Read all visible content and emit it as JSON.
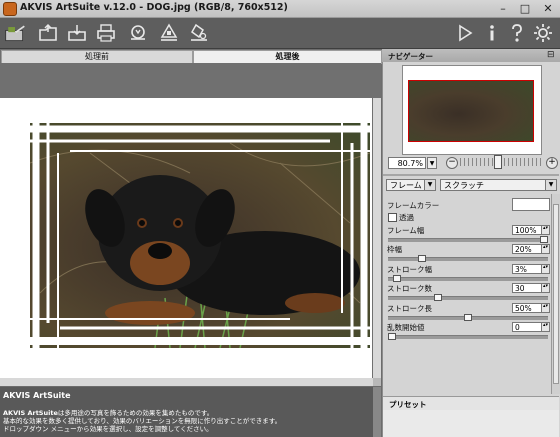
{
  "window": {
    "title": "AKVIS ArtSuite v.12.0 - DOG.jpg (RGB/8, 760x512)",
    "controls": [
      "–",
      "□",
      "✕"
    ]
  },
  "toolbar": {
    "buttons": [
      "home-icon",
      "open-icon",
      "save-icon",
      "print-icon",
      "share-icon",
      "before-icon",
      "after-icon"
    ],
    "right_buttons": [
      "run-icon",
      "info-icon",
      "help-icon",
      "settings-icon"
    ]
  },
  "tabs": {
    "before": "処理前",
    "after": "処理後"
  },
  "help": {
    "title": "AKVIS ArtSuite",
    "line1_brand": "AKVIS ArtSuite",
    "line1_rest": "は多用途の写真を飾るための効果を集めたものです。",
    "line2": "基本的な効果を数多く提供しており、効果のバリエーションを無限に作り出すことができます。",
    "line3": "ドロップダウン メニューから効果を選択し、設定を調整してください。"
  },
  "navigator": {
    "title": "ナビゲーター",
    "zoom": "80.7%",
    "zoom_position": 0.45
  },
  "effect": {
    "category": "フレーム",
    "type": "スクラッチ"
  },
  "settings": {
    "frame_color_label": "フレームカラー",
    "frame_color": "#ffffff",
    "transparent_label": "透過",
    "transparent_checked": false,
    "frame_width": {
      "label": "フレーム幅",
      "value": "100%",
      "level": 1.0
    },
    "border_width": {
      "label": "枠幅",
      "value": "20%",
      "level": 0.2
    },
    "stroke_width": {
      "label": "ストローク幅",
      "value": "3%",
      "level": 0.03
    },
    "stroke_count": {
      "label": "ストローク数",
      "value": "30",
      "level": 0.3
    },
    "stroke_length": {
      "label": "ストローク長",
      "value": "50%",
      "level": 0.5
    },
    "seed": {
      "label": "乱数開始値",
      "value": "0",
      "level": 0.0
    }
  },
  "presets": {
    "title": "プリセット"
  }
}
